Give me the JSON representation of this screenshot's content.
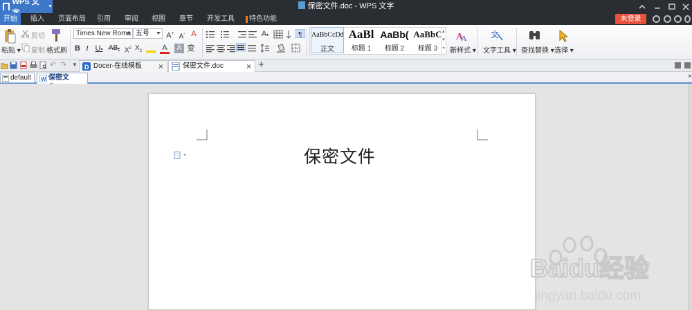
{
  "app": {
    "name": "WPS 文字",
    "window_title": "保密文件.doc - WPS 文字"
  },
  "menu": [
    "开始",
    "插入",
    "页面布局",
    "引用",
    "审阅",
    "视图",
    "章节",
    "开发工具",
    "特色功能"
  ],
  "login_label": "未登录",
  "ribbon": {
    "paste_label": "粘贴",
    "cut_label": "剪切",
    "copy_label": "复制",
    "format_painter_label": "格式刷",
    "font_name": "Times New Roma",
    "font_size": "五号",
    "styles": [
      {
        "preview": "AaBbCcDd",
        "label": "正文"
      },
      {
        "preview": "AaBl",
        "label": "标题 1"
      },
      {
        "preview": "AaBb(",
        "label": "标题 2"
      },
      {
        "preview": "AaBbC",
        "label": "标题 3"
      }
    ],
    "new_style_label": "新样式",
    "text_tools_label": "文字工具",
    "find_replace_label": "查找替换",
    "select_label": "选择"
  },
  "doc_tabs": [
    {
      "label": "Docer-在线模板"
    },
    {
      "label": "保密文件.doc"
    }
  ],
  "workspace_tab": "default",
  "file_tab": "保密文件.doc",
  "document": {
    "heading": "保密文件"
  },
  "watermark": {
    "brand": "Baidu经验",
    "url": "jingyan.baidu.com"
  },
  "colors": {
    "titlebar": "#2a2d32",
    "accent": "#3d78c9",
    "login": "#e8523d"
  }
}
